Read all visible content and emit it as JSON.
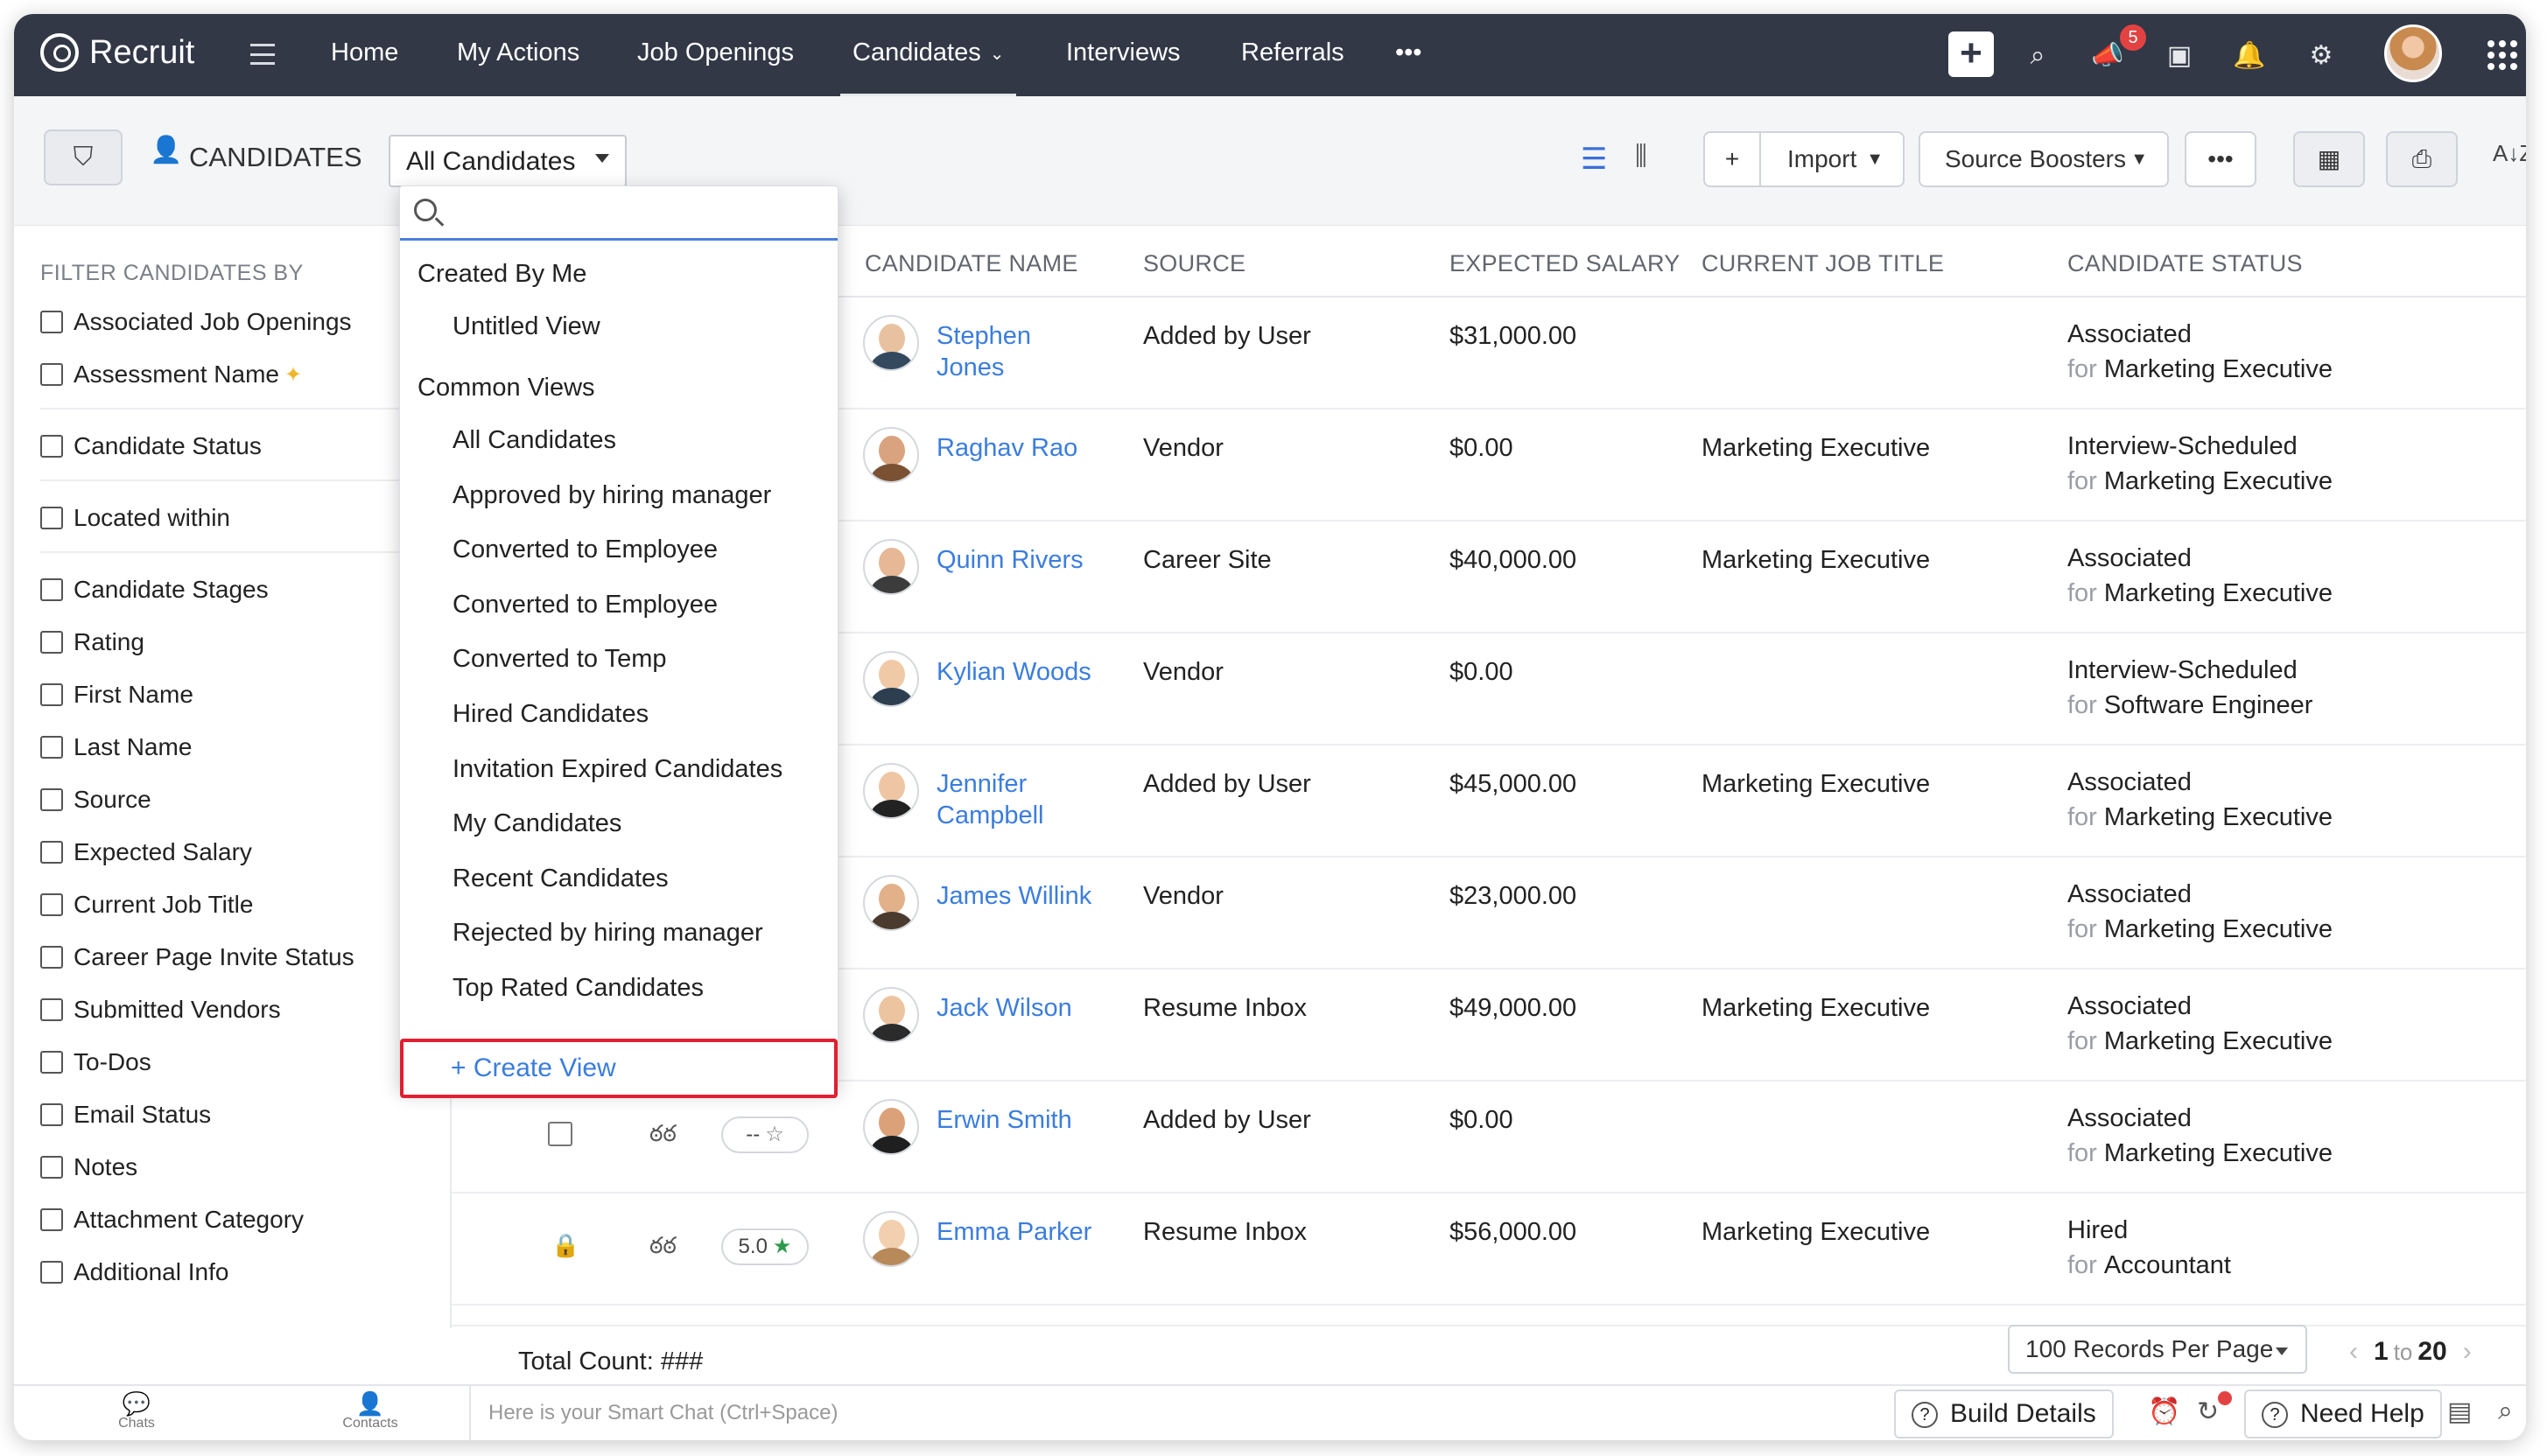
{
  "app": {
    "name": "Recruit"
  },
  "nav": {
    "items": [
      "Home",
      "My Actions",
      "Job Openings",
      "Candidates",
      "Interviews",
      "Referrals"
    ],
    "active": "Candidates",
    "more": "•••",
    "notification_count": "5"
  },
  "subheader": {
    "title": "CANDIDATES",
    "view_select": "All Candidates",
    "buttons": {
      "import": "Import",
      "source_boosters": "Source Boosters",
      "more": "•••"
    }
  },
  "filters": {
    "heading": "FILTER CANDIDATES BY",
    "items": [
      "Associated Job Openings",
      "Assessment Name",
      "Candidate Status",
      "Located within",
      "Candidate Stages",
      "Rating",
      "First Name",
      "Last Name",
      "Source",
      "Expected Salary",
      "Current Job Title",
      "Career Page Invite Status",
      "Submitted Vendors",
      "To-Dos",
      "Email Status",
      "Notes",
      "Attachment Category",
      "Additional Info"
    ]
  },
  "table": {
    "columns": [
      "CANDIDATE NAME",
      "SOURCE",
      "EXPECTED SALARY",
      "CURRENT JOB TITLE",
      "CANDIDATE STATUS"
    ],
    "for_word": "for",
    "rows": [
      {
        "name": "Stephen Jones",
        "source": "Added by User",
        "salary": "$31,000.00",
        "title": "",
        "status": "Associated",
        "job": "Marketing Executive",
        "rating": ""
      },
      {
        "name": "Raghav Rao",
        "source": "Vendor",
        "salary": "$0.00",
        "title": "Marketing Executive",
        "status": "Interview-Scheduled",
        "job": "Marketing Executive",
        "rating": ""
      },
      {
        "name": "Quinn Rivers",
        "source": "Career Site",
        "salary": "$40,000.00",
        "title": "Marketing Executive",
        "status": "Associated",
        "job": "Marketing Executive",
        "rating": ""
      },
      {
        "name": "Kylian Woods",
        "source": "Vendor",
        "salary": "$0.00",
        "title": "",
        "status": "Interview-Scheduled",
        "job": "Software Engineer",
        "rating": ""
      },
      {
        "name": "Jennifer Campbell",
        "source": "Added by User",
        "salary": "$45,000.00",
        "title": "Marketing Executive",
        "status": "Associated",
        "job": "Marketing Executive",
        "rating": ""
      },
      {
        "name": "James Willink",
        "source": "Vendor",
        "salary": "$23,000.00",
        "title": "",
        "status": "Associated",
        "job": "Marketing Executive",
        "rating": ""
      },
      {
        "name": "Jack Wilson",
        "source": "Resume Inbox",
        "salary": "$49,000.00",
        "title": "Marketing Executive",
        "status": "Associated",
        "job": "Marketing Executive",
        "rating": ""
      },
      {
        "name": "Erwin Smith",
        "source": "Added by User",
        "salary": "$0.00",
        "title": "",
        "status": "Associated",
        "job": "Marketing Executive",
        "rating": "--"
      },
      {
        "name": "Emma Parker",
        "source": "Resume Inbox",
        "salary": "$56,000.00",
        "title": "Marketing Executive",
        "status": "Hired",
        "job": "Accountant",
        "rating": "5.0"
      }
    ],
    "total_count": "Total Count: ###",
    "records_per_page": "100 Records Per Page",
    "pager": {
      "from": "1",
      "to_word": "to",
      "to": "20"
    }
  },
  "dropdown": {
    "search_placeholder": "",
    "groups": [
      {
        "label": "Created By Me",
        "items": [
          "Untitled View"
        ]
      },
      {
        "label": "Common Views",
        "items": [
          "All Candidates",
          "Approved by hiring manager",
          "Converted to Employee",
          "Converted to Employee",
          "Converted to Temp",
          "Hired Candidates",
          "Invitation Expired Candidates",
          "My Candidates",
          "Recent Candidates",
          "Rejected by hiring manager",
          "Top Rated Candidates"
        ]
      }
    ],
    "create_view": "+ Create View"
  },
  "bottom_bar": {
    "chats": "Chats",
    "contacts": "Contacts",
    "smart_chat_placeholder": "Here is your Smart Chat (Ctrl+Space)",
    "build_details": "Build Details",
    "need_help": "Need Help"
  }
}
